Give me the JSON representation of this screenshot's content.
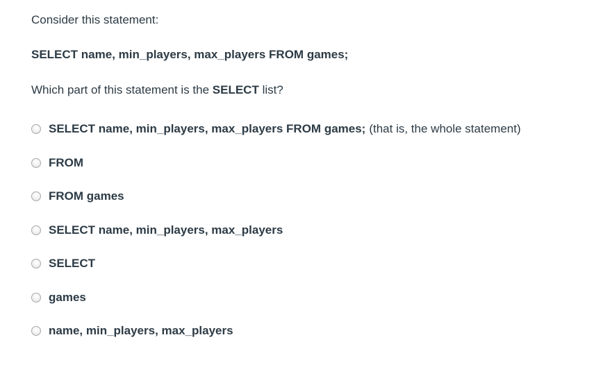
{
  "prompt": {
    "intro": "Consider this statement:",
    "sql_statement": "SELECT name, min_players, max_players FROM games;",
    "question_before": "Which part of this statement is the ",
    "question_keyword": "SELECT",
    "question_after": " list?"
  },
  "answers": [
    {
      "label": "SELECT name, min_players, max_players FROM games;",
      "note": "(that is, the whole statement)",
      "selected": false
    },
    {
      "label": "FROM",
      "note": "",
      "selected": false
    },
    {
      "label": "FROM games",
      "note": "",
      "selected": false
    },
    {
      "label": "SELECT name, min_players, max_players",
      "note": "",
      "selected": false
    },
    {
      "label": "SELECT",
      "note": "",
      "selected": false
    },
    {
      "label": "games",
      "note": "",
      "selected": false
    },
    {
      "label": "name, min_players, max_players",
      "note": "",
      "selected": false
    }
  ]
}
